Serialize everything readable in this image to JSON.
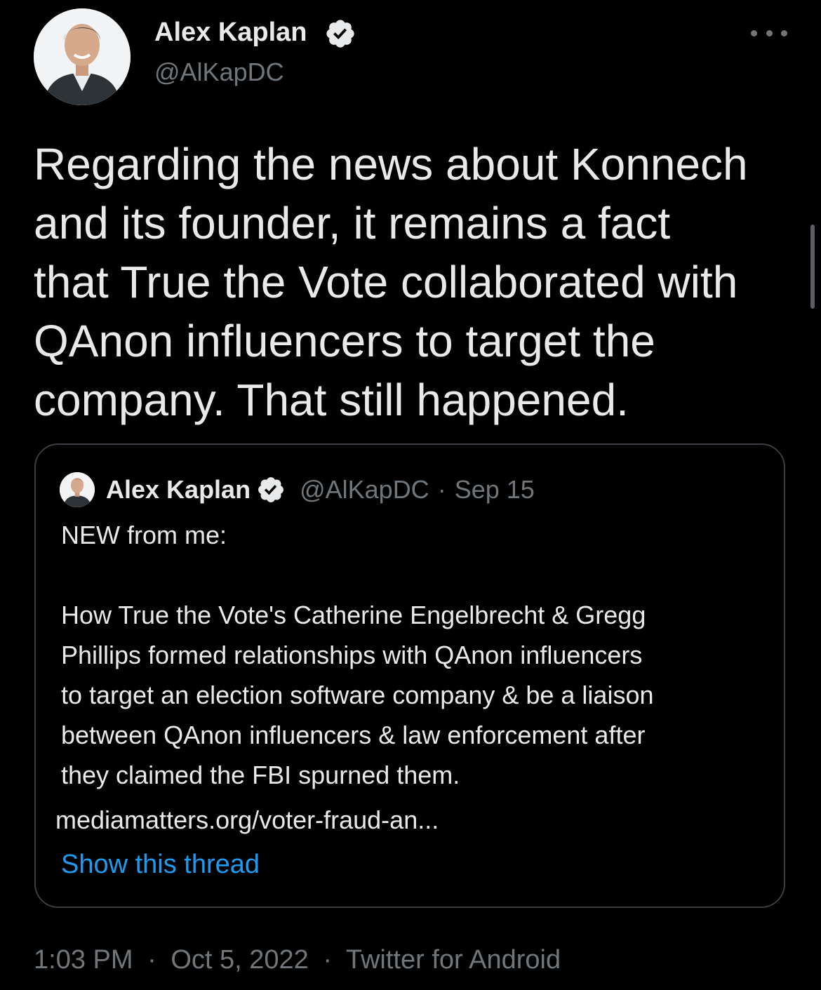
{
  "tweet": {
    "author": {
      "name": "Alex Kaplan",
      "handle": "@AlKapDC",
      "verified": true
    },
    "text_lines": [
      "Regarding the news about Konnech",
      "and its founder, it remains a fact",
      "that True the Vote collaborated with",
      "QAnon influencers to target the",
      "company. That still happened."
    ],
    "quoted": {
      "author": {
        "name": "Alex Kaplan",
        "handle": "@AlKapDC",
        "verified": true
      },
      "separator": "·",
      "date": "Sep 15",
      "body_lines": [
        "NEW from me:",
        "",
        "How True the Vote's Catherine Engelbrecht & Gregg",
        "Phillips formed relationships with QAnon influencers",
        "to target an election software company & be a liaison",
        "between QAnon influencers & law enforcement after",
        "they claimed the FBI spurned them."
      ],
      "link": "mediamatters.org/voter-fraud-an...",
      "show_thread_label": "Show this thread"
    },
    "meta": {
      "time": "1:03 PM",
      "date": "Oct 5, 2022",
      "source": "Twitter for Android",
      "separator": "·"
    }
  },
  "colors": {
    "background": "#000000",
    "text_primary": "#e7e9ea",
    "text_secondary": "#71767b",
    "link": "#1d9bf0",
    "border": "#3a3d41"
  },
  "icons": [
    "avatar",
    "verified-badge-icon",
    "more-options-icon"
  ]
}
